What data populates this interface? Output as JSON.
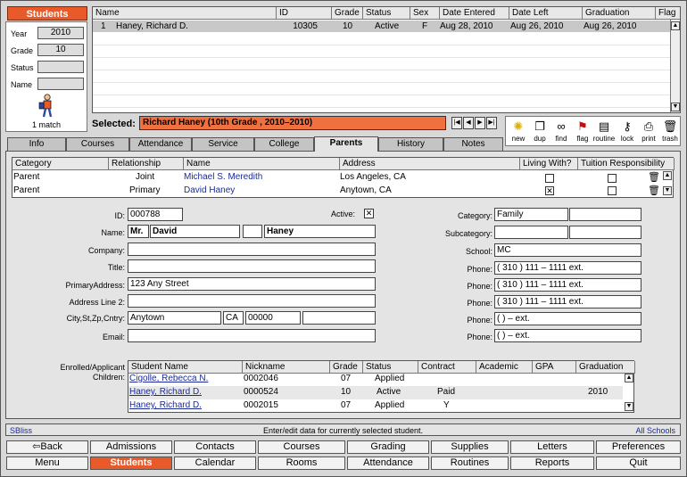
{
  "left": {
    "title": "Students",
    "year_label": "Year",
    "year_value": "2010",
    "grade_label": "Grade",
    "grade_value": "10",
    "status_label": "Status",
    "status_value": "",
    "name_label": "Name",
    "name_value": "",
    "match_text": "1 match"
  },
  "grid": {
    "headers": [
      "Name",
      "ID",
      "Grade",
      "Status",
      "Sex",
      "Date Entered",
      "Date Left",
      "Graduation",
      "Flag"
    ],
    "row": {
      "num": "1",
      "name": "Haney, Richard D.",
      "id": "10305",
      "grade": "10",
      "status": "Active",
      "sex": "F",
      "entered": "Aug 28, 2010",
      "left": "Aug 26, 2010",
      "grad": "Aug 26, 2010"
    }
  },
  "selected": {
    "label": "Selected:",
    "value": "Richard Haney (10th Grade , 2010–2010)"
  },
  "toolbar": [
    "new",
    "dup",
    "find",
    "flag",
    "routine",
    "lock",
    "print",
    "trash"
  ],
  "tabs": [
    "Info",
    "Courses",
    "Attendance",
    "Service",
    "College",
    "Parents",
    "History",
    "Notes"
  ],
  "parents": {
    "headers": [
      "Category",
      "Relationship",
      "Name",
      "Address",
      "Living With?",
      "Tuition Responsibility"
    ],
    "rows": [
      {
        "category": "Parent",
        "relationship": "Joint",
        "name": "Michael S. Meredith",
        "address": "Los Angeles, CA"
      },
      {
        "category": "Parent",
        "relationship": "Primary",
        "name": "David Haney",
        "address": "Anytown, CA"
      }
    ]
  },
  "form": {
    "id_label": "ID:",
    "id_value": "000788",
    "active_label": "Active:",
    "name_label": "Name:",
    "prefix": "Mr.",
    "first": "David",
    "middle": "",
    "last": "Haney",
    "company_label": "Company:",
    "title_label": "Title:",
    "address_label": "PrimaryAddress:",
    "address_value": "123 Any Street",
    "address2_label": "Address Line 2:",
    "city_label": "City,St,Zp,Cntry:",
    "city": "Anytown",
    "state": "CA",
    "zip": "00000",
    "country": "",
    "email_label": "Email:",
    "category_label": "Category:",
    "category_value": "Family",
    "subcategory_label": "Subcategory:",
    "school_label": "School:",
    "school_value": "MC",
    "phone_label": "Phone:",
    "phones": [
      "( 310 )  111  –  1111  ext.",
      "( 310 )  111  –  1111  ext.",
      "( 310 )  111  –  1111  ext.",
      "(        )          –          ext.",
      "(        )          –          ext."
    ]
  },
  "children": {
    "label1": "Enrolled/Applicant",
    "label2": "Children:",
    "headers": [
      "Student Name",
      "Nickname",
      "Grade",
      "Status",
      "Contract",
      "Academic",
      "GPA",
      "Graduation"
    ],
    "rows": [
      {
        "name": "Cigolle, Rebecca N.",
        "nick": "0002046",
        "grade": "07",
        "status": "Applied",
        "contract": "",
        "grad": ""
      },
      {
        "name": "Haney, Richard D.",
        "nick": "0000524",
        "grade": "10",
        "status": "Active",
        "contract": "Paid",
        "grad": "2010"
      },
      {
        "name": "Haney, Richard D.",
        "nick": "0002015",
        "grade": "07",
        "status": "Applied",
        "contract": "Y",
        "grad": ""
      }
    ]
  },
  "status_bar": {
    "left": "SBliss",
    "center": "Enter/edit data for currently selected student.",
    "right": "All Schools"
  },
  "nav_row1": [
    "Back",
    "Admissions",
    "Contacts",
    "Courses",
    "Grading",
    "Supplies",
    "Letters",
    "Preferences"
  ],
  "nav_row2": [
    "Menu",
    "Students",
    "Calendar",
    "Rooms",
    "Attendance",
    "Routines",
    "Reports",
    "Quit"
  ]
}
